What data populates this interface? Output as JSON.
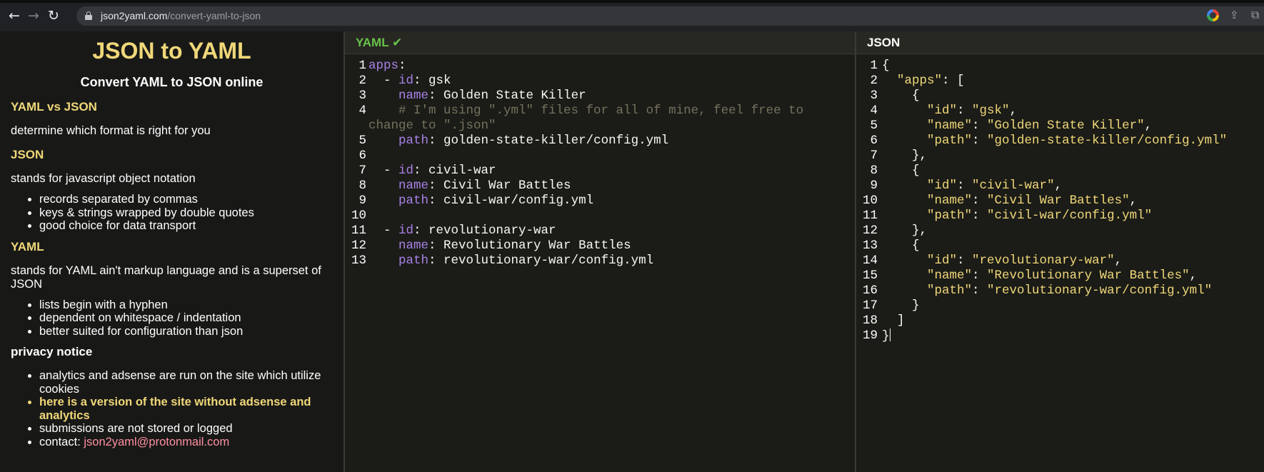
{
  "browser": {
    "url_host": "json2yaml.com",
    "url_path": "/convert-yaml-to-json",
    "back_glyph": "←",
    "forward_glyph": "→",
    "reload_glyph": "↻",
    "share_glyph": "⇪",
    "extensions_glyph": "⧉"
  },
  "sidebar": {
    "title": "JSON to YAML",
    "subtitle": "Convert YAML to JSON online",
    "yaml_vs_json_heading": "YAML vs JSON",
    "yaml_vs_json_text": "determine which format is right for you",
    "json_heading": "JSON",
    "json_text": "stands for javascript object notation",
    "json_points": [
      "records separated by commas",
      "keys & strings wrapped by double quotes",
      "good choice for data transport"
    ],
    "yaml_heading": "YAML",
    "yaml_text": "stands for YAML ain't markup language and is a superset of JSON",
    "yaml_points": [
      "lists begin with a hyphen",
      "dependent on whitespace / indentation",
      "better suited for configuration than json"
    ],
    "privacy_heading": "privacy notice",
    "privacy_points": [
      "analytics and adsense are run on the site which utilize cookies",
      "here is a version of the site without adsense and analytics",
      "submissions are not stored or logged"
    ],
    "contact_label": "contact: ",
    "contact_email": "json2yaml@protonmail.com"
  },
  "yaml_panel": {
    "title": "YAML",
    "status_glyph": "✔",
    "lines": [
      [
        [
          "k",
          "apps"
        ],
        [
          "w",
          ":"
        ]
      ],
      [
        [
          "w",
          "  - "
        ],
        [
          "k",
          "id"
        ],
        [
          "w",
          ": gsk"
        ]
      ],
      [
        [
          "w",
          "    "
        ],
        [
          "k",
          "name"
        ],
        [
          "w",
          ": Golden State Killer"
        ]
      ],
      [
        [
          "c",
          "    # I'm using \".yml\" files for all of mine, feel free to"
        ]
      ],
      [
        [
          "c",
          "change to \".json\""
        ]
      ],
      [
        [
          "w",
          "    "
        ],
        [
          "k",
          "path"
        ],
        [
          "w",
          ": golden-state-killer/config.yml"
        ]
      ],
      [],
      [
        [
          "w",
          "  - "
        ],
        [
          "k",
          "id"
        ],
        [
          "w",
          ": civil-war"
        ]
      ],
      [
        [
          "w",
          "    "
        ],
        [
          "k",
          "name"
        ],
        [
          "w",
          ": Civil War Battles"
        ]
      ],
      [
        [
          "w",
          "    "
        ],
        [
          "k",
          "path"
        ],
        [
          "w",
          ": civil-war/config.yml"
        ]
      ],
      [],
      [
        [
          "w",
          "  - "
        ],
        [
          "k",
          "id"
        ],
        [
          "w",
          ": revolutionary-war"
        ]
      ],
      [
        [
          "w",
          "    "
        ],
        [
          "k",
          "name"
        ],
        [
          "w",
          ": Revolutionary War Battles"
        ]
      ],
      [
        [
          "w",
          "    "
        ],
        [
          "k",
          "path"
        ],
        [
          "w",
          ": revolutionary-war/config.yml"
        ]
      ]
    ],
    "line_numbers": [
      "1",
      "2",
      "3",
      "4",
      "",
      "5",
      "6",
      "7",
      "8",
      "9",
      "10",
      "11",
      "12",
      "13"
    ]
  },
  "json_panel": {
    "title": "JSON",
    "lines": [
      [
        [
          "w",
          "{"
        ]
      ],
      [
        [
          "w",
          "  "
        ],
        [
          "s",
          "\"apps\""
        ],
        [
          "w",
          ": ["
        ]
      ],
      [
        [
          "w",
          "    {"
        ]
      ],
      [
        [
          "w",
          "      "
        ],
        [
          "s",
          "\"id\""
        ],
        [
          "w",
          ": "
        ],
        [
          "s",
          "\"gsk\""
        ],
        [
          "w",
          ","
        ]
      ],
      [
        [
          "w",
          "      "
        ],
        [
          "s",
          "\"name\""
        ],
        [
          "w",
          ": "
        ],
        [
          "s",
          "\"Golden State Killer\""
        ],
        [
          "w",
          ","
        ]
      ],
      [
        [
          "w",
          "      "
        ],
        [
          "s",
          "\"path\""
        ],
        [
          "w",
          ": "
        ],
        [
          "s",
          "\"golden-state-killer/config.yml\""
        ]
      ],
      [
        [
          "w",
          "    },"
        ]
      ],
      [
        [
          "w",
          "    {"
        ]
      ],
      [
        [
          "w",
          "      "
        ],
        [
          "s",
          "\"id\""
        ],
        [
          "w",
          ": "
        ],
        [
          "s",
          "\"civil-war\""
        ],
        [
          "w",
          ","
        ]
      ],
      [
        [
          "w",
          "      "
        ],
        [
          "s",
          "\"name\""
        ],
        [
          "w",
          ": "
        ],
        [
          "s",
          "\"Civil War Battles\""
        ],
        [
          "w",
          ","
        ]
      ],
      [
        [
          "w",
          "      "
        ],
        [
          "s",
          "\"path\""
        ],
        [
          "w",
          ": "
        ],
        [
          "s",
          "\"civil-war/config.yml\""
        ]
      ],
      [
        [
          "w",
          "    },"
        ]
      ],
      [
        [
          "w",
          "    {"
        ]
      ],
      [
        [
          "w",
          "      "
        ],
        [
          "s",
          "\"id\""
        ],
        [
          "w",
          ": "
        ],
        [
          "s",
          "\"revolutionary-war\""
        ],
        [
          "w",
          ","
        ]
      ],
      [
        [
          "w",
          "      "
        ],
        [
          "s",
          "\"name\""
        ],
        [
          "w",
          ": "
        ],
        [
          "s",
          "\"Revolutionary War Battles\""
        ],
        [
          "w",
          ","
        ]
      ],
      [
        [
          "w",
          "      "
        ],
        [
          "s",
          "\"path\""
        ],
        [
          "w",
          ": "
        ],
        [
          "s",
          "\"revolutionary-war/config.yml\""
        ]
      ],
      [
        [
          "w",
          "    }"
        ]
      ],
      [
        [
          "w",
          "  ]"
        ]
      ],
      [
        [
          "w",
          "}"
        ]
      ]
    ],
    "line_numbers": [
      "1",
      "2",
      "3",
      "4",
      "5",
      "6",
      "7",
      "8",
      "9",
      "10",
      "11",
      "12",
      "13",
      "14",
      "15",
      "16",
      "17",
      "18",
      "19"
    ]
  },
  "colors": {
    "accent_yellow": "#f0d779",
    "ok_green": "#66c24a",
    "keyword_purple": "#a981e8",
    "comment_gray": "#75715e",
    "email_pink": "#ff8fa0"
  }
}
